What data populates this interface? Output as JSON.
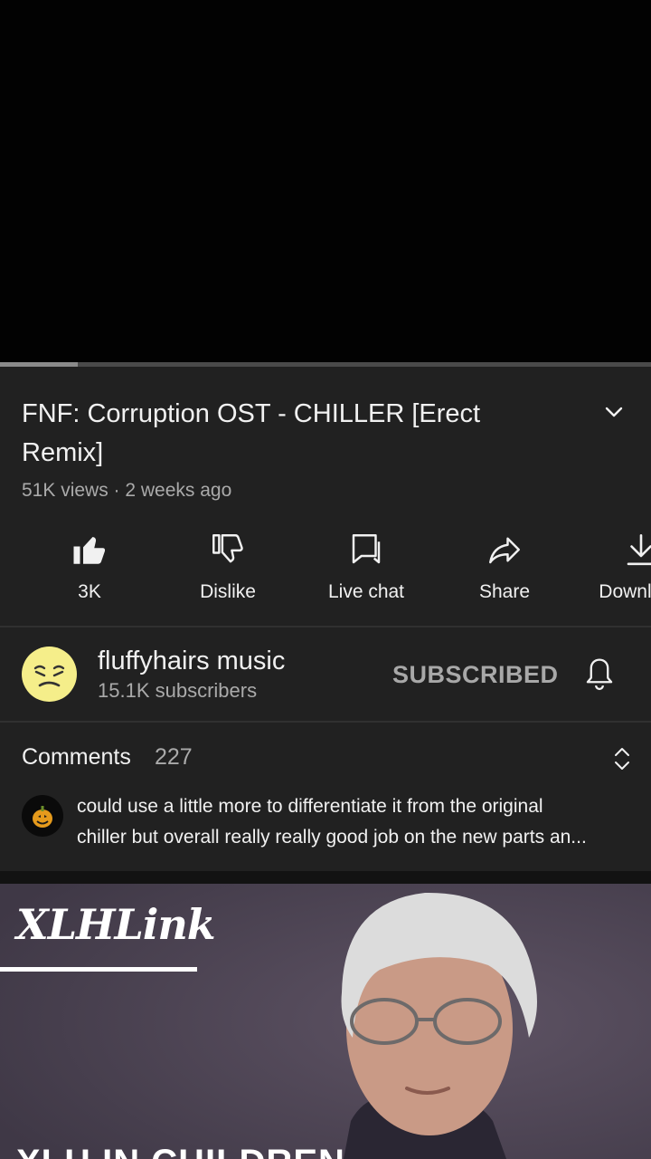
{
  "video": {
    "title": "FNF: Corruption OST - CHILLER [Erect Remix]",
    "meta": "51K views · 2 weeks ago",
    "progress": 0.12
  },
  "actions": [
    {
      "label": "3K",
      "icon": "thumbs-up-filled-icon"
    },
    {
      "label": "Dislike",
      "icon": "thumbs-down-icon"
    },
    {
      "label": "Live chat",
      "icon": "live-chat-icon"
    },
    {
      "label": "Share",
      "icon": "share-icon"
    },
    {
      "label": "Download",
      "icon": "download-icon"
    }
  ],
  "channel": {
    "name": "fluffyhairs music",
    "subscribers": "15.1K subscribers",
    "subscribe_label": "SUBSCRIBED",
    "avatar_color": "#f5ee8a"
  },
  "comments": {
    "title": "Comments",
    "count": "227",
    "top_comment_line1": "could use a little more to differentiate it from the original",
    "top_comment_line2": "chiller but overall really really good job on the new parts an..."
  },
  "next_video": {
    "logo_text": "XLHLink",
    "bottom_text": "XLH IN CHILDREN"
  },
  "colors": {
    "background": "#212121",
    "player": "#020202",
    "secondary_text": "#aaaaaa"
  }
}
